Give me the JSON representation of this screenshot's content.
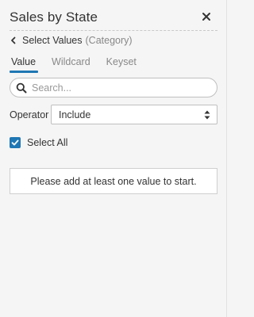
{
  "panel": {
    "title": "Sales by State",
    "close_icon": "close-icon"
  },
  "breadcrumb": {
    "back_icon": "chevron-left-icon",
    "label": "Select Values",
    "sublabel": "(Category)"
  },
  "tabs": [
    {
      "label": "Value",
      "active": true
    },
    {
      "label": "Wildcard",
      "active": false
    },
    {
      "label": "Keyset",
      "active": false
    }
  ],
  "search": {
    "icon": "search-icon",
    "placeholder": "Search...",
    "value": ""
  },
  "operator": {
    "label": "Operator",
    "selected": "Include",
    "icon": "up-down-arrows-icon"
  },
  "select_all": {
    "label": "Select All",
    "checked": true
  },
  "empty_state": {
    "message": "Please add at least one value to start."
  },
  "colors": {
    "accent": "#1f77b4",
    "background": "#f5f5f5",
    "text": "#333333",
    "muted_text": "#888888"
  }
}
